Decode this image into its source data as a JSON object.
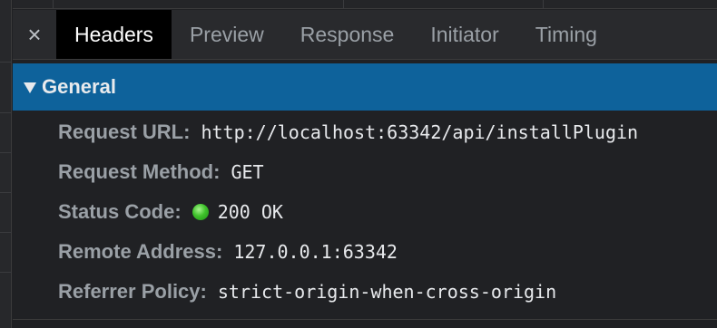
{
  "tabs": {
    "close_glyph": "×",
    "items": [
      {
        "label": "Headers",
        "active": true
      },
      {
        "label": "Preview",
        "active": false
      },
      {
        "label": "Response",
        "active": false
      },
      {
        "label": "Initiator",
        "active": false
      },
      {
        "label": "Timing",
        "active": false
      }
    ]
  },
  "general": {
    "title": "General",
    "expanded": true,
    "rows": [
      {
        "key": "Request URL:",
        "value": "http://localhost:63342/api/installPlugin"
      },
      {
        "key": "Request Method:",
        "value": "GET"
      },
      {
        "key": "Status Code:",
        "value": "200 OK",
        "status_icon": "green-circle-icon"
      },
      {
        "key": "Remote Address:",
        "value": "127.0.0.1:63342"
      },
      {
        "key": "Referrer Policy:",
        "value": "strict-origin-when-cross-origin"
      }
    ]
  },
  "colors": {
    "background": "#202124",
    "tabbar": "#292a2d",
    "active_tab": "#000000",
    "section_header": "#0e629b",
    "key_text": "#9aa0a6",
    "value_text": "#e8eaed",
    "status_ok": "#3fc22b"
  }
}
